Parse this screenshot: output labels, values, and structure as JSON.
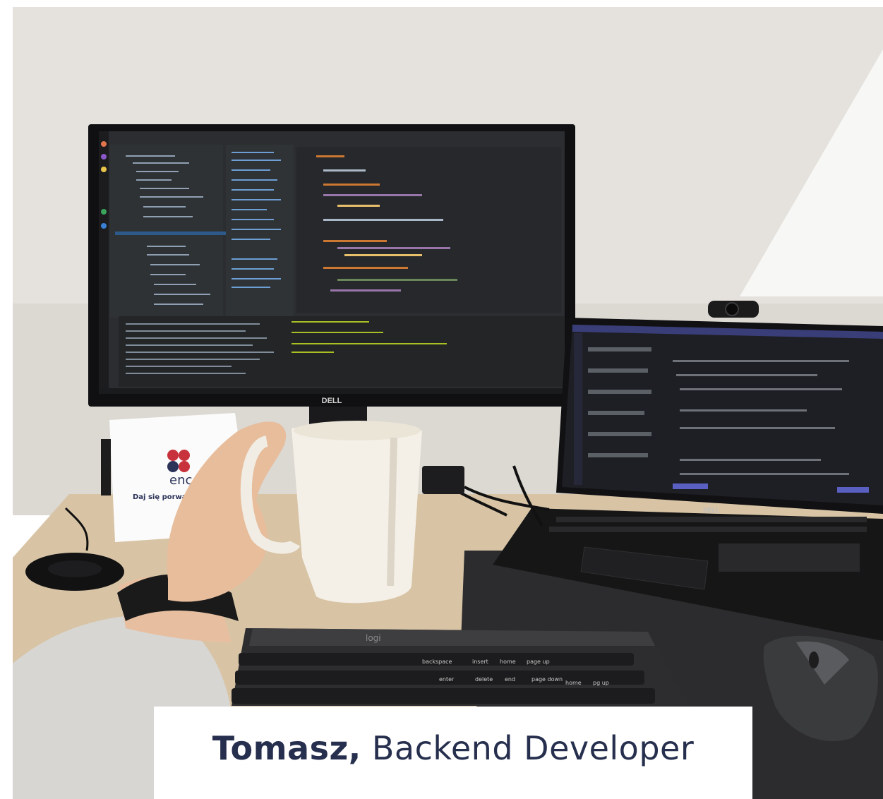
{
  "caption": {
    "name": "Tomasz,",
    "role": "Backend Developer"
  },
  "card": {
    "brand": "enc",
    "tagline": "Daj się porwa"
  },
  "monitor": {
    "brand": "DELL"
  },
  "laptop": {
    "brand": "DELL"
  },
  "keyboard": {
    "brand": "logi",
    "keys": [
      "backspace",
      "insert",
      "home",
      "page up",
      "enter",
      "delete",
      "end",
      "page down",
      "home",
      "pg up"
    ]
  },
  "colors": {
    "wall": "#e4e1dc",
    "desk": "#d9c5a6",
    "caption_text": "#262f4d",
    "brand_red": "#c8323c",
    "brand_navy": "#2b3358"
  }
}
